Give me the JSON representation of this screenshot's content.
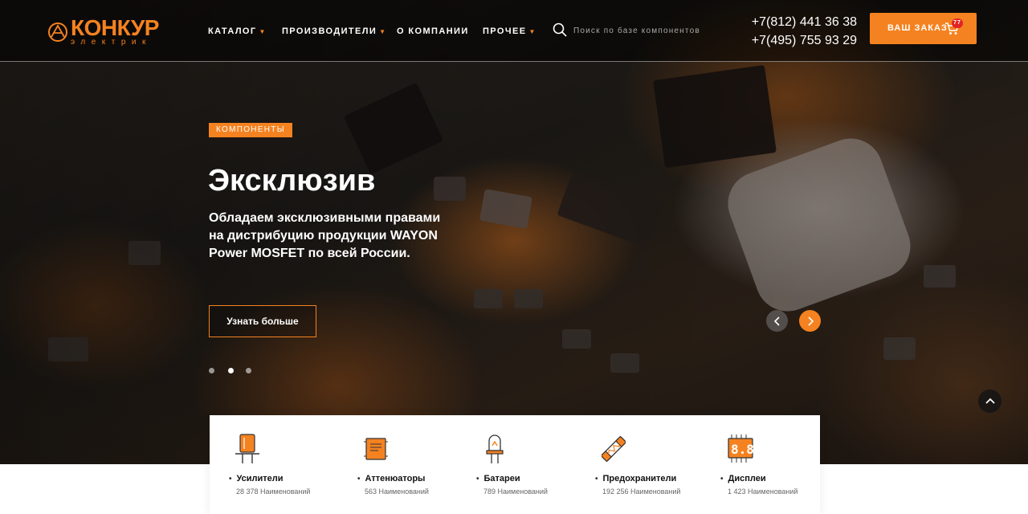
{
  "brand": {
    "name": "КОНКУР",
    "subtitle": "электрик"
  },
  "nav": [
    {
      "label": "КАТАЛОГ",
      "has_dropdown": true
    },
    {
      "label": "ПРОИЗВОДИТЕЛИ",
      "has_dropdown": true
    },
    {
      "label": "О КОМПАНИИ",
      "has_dropdown": false
    },
    {
      "label": "ПРОЧЕЕ",
      "has_dropdown": true
    }
  ],
  "search": {
    "placeholder": "Поиск по базе компонентов",
    "icon": "search-icon"
  },
  "contacts": {
    "phones": [
      "+7(812) 441 36 38",
      "+7(495) 755 93 29"
    ]
  },
  "order": {
    "label": "ВАШ ЗАКАЗ",
    "cart_count": "77",
    "icon": "cart-icon"
  },
  "slide": {
    "badge": "КОМПОНЕНТЫ",
    "title": "Эксклюзив",
    "text": "Обладаем эксклюзивными правами на дистрибуцию продукции WAYON Power MOSFET по всей России.",
    "button": "Узнать больше",
    "dots_count": 3,
    "active_dot": 1
  },
  "categories": [
    {
      "name": "Усилители",
      "count": "28 378 Наименований",
      "icon": "amplifier-icon"
    },
    {
      "name": "Аттенюаторы",
      "count": "563 Наименований",
      "icon": "attenuator-chip-icon"
    },
    {
      "name": "Батареи",
      "count": "789 Наименований",
      "icon": "led-battery-icon"
    },
    {
      "name": "Предохранители",
      "count": "192 256 Наименований",
      "icon": "fuse-icon"
    },
    {
      "name": "Дисплеи",
      "count": "1 423 Наименований",
      "icon": "display-icon"
    }
  ],
  "colors": {
    "accent": "#f58220",
    "badge_red": "#e02424",
    "header_bg": "#000000"
  }
}
